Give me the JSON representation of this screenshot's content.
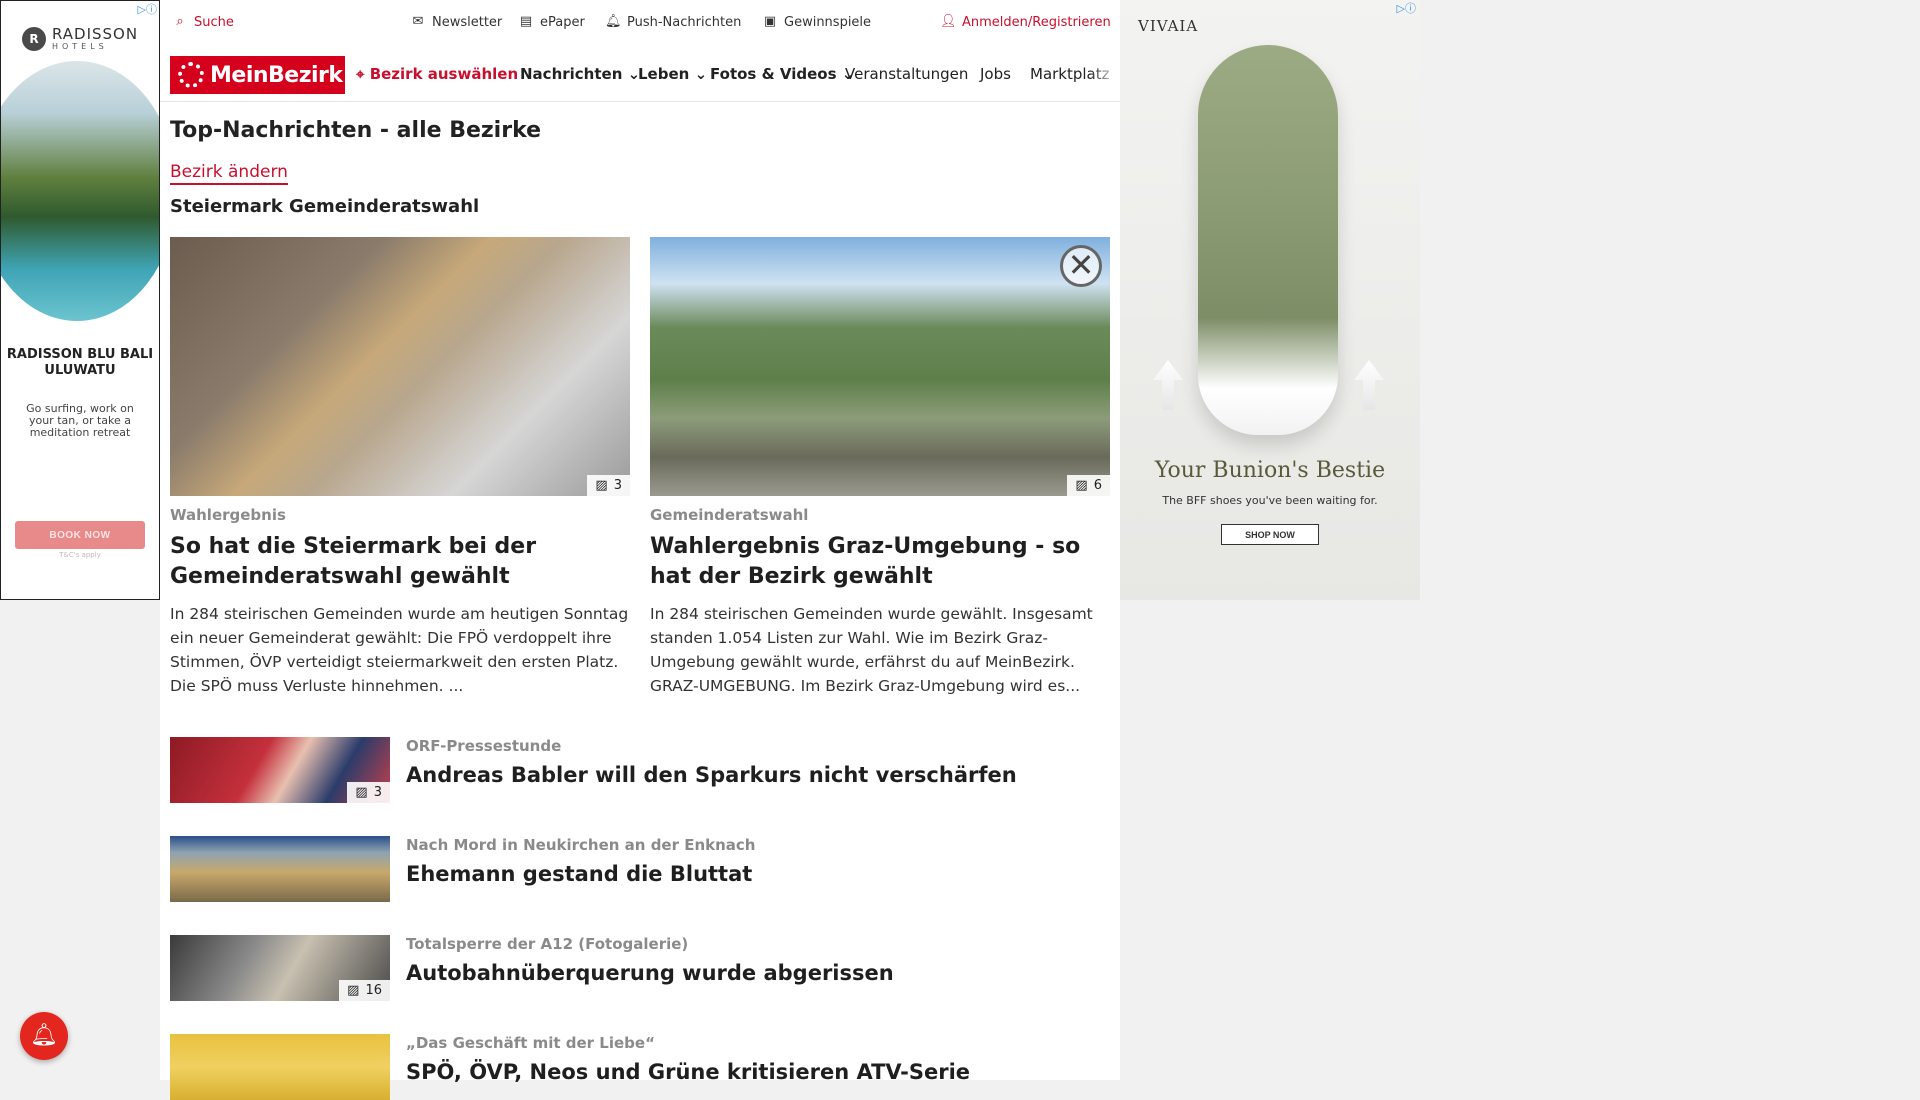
{
  "ad_left": {
    "brand": "RADISSON",
    "brand_sub": "HOTELS",
    "headline": "RADISSON BLU BALI ULUWATU",
    "copy": "Go surfing, work on your tan, or take a meditation retreat",
    "cta": "BOOK NOW",
    "fine_print": "T&C's apply"
  },
  "topbar": {
    "search": "Suche",
    "newsletter": "Newsletter",
    "epaper": "ePaper",
    "push": "Push-Nachrichten",
    "games": "Gewinnspiele",
    "login": "Anmelden/Registrieren"
  },
  "nav": {
    "brand": "MeinBezirk",
    "district": "Bezirk auswählen",
    "items": [
      "Nachrichten",
      "Leben",
      "Fotos & Videos",
      "Veranstaltungen",
      "Jobs",
      "Marktplatz"
    ]
  },
  "page": {
    "title": "Top-Nachrichten - alle Bezirke",
    "change_link": "Bezirk ändern",
    "section": "Steiermark Gemeinderatswahl"
  },
  "features": [
    {
      "kicker": "Wahlergebnis",
      "headline": "So hat die Steiermark bei der Gemeinderatswahl gewählt",
      "teaser": "In 284 steirischen Gemeinden wurde am heutigen Sonntag ein neuer Gemeinderat gewählt: Die FPÖ verdoppelt ihre Stimmen, ÖVP verteidigt steiermarkweit den ersten Platz. Die SPÖ muss Verluste hinnehmen. ...",
      "photo_count": "3"
    },
    {
      "kicker": "Gemeinderatswahl",
      "headline": "Wahlergebnis Graz-Umgebung - so hat der Bezirk gewählt",
      "teaser": "In 284 steirischen Gemeinden wurde gewählt. Insgesamt standen 1.054 Listen zur Wahl. Wie im Bezirk Graz-Umgebung gewählt wurde, erfährst du auf MeinBezirk. GRAZ-UMGEBUNG. Im Bezirk Graz-Umgebung wird es...",
      "photo_count": "6"
    }
  ],
  "list": [
    {
      "kicker": "ORF-Pressestunde",
      "headline": "Andreas Babler will den Sparkurs nicht verschärfen",
      "photo_count": "3"
    },
    {
      "kicker": "Nach Mord in Neukirchen an der Enknach",
      "headline": "Ehemann gestand die Bluttat",
      "photo_count": ""
    },
    {
      "kicker": "Totalsperre der A12 (Fotogalerie)",
      "headline": "Autobahnüberquerung wurde abgerissen",
      "photo_count": "16"
    },
    {
      "kicker": "„Das Geschäft mit der Liebe“",
      "headline": "SPÖ, ÖVP, Neos und Grüne kritisieren ATV-Serie",
      "photo_count": ""
    }
  ],
  "ad_right": {
    "brand": "VIVAIA",
    "tagline": "Your Bunion's Bestie",
    "sub": "The BFF shoes you've been waiting for.",
    "cta": "SHOP NOW"
  },
  "colors": {
    "brand_red": "#d5001c",
    "link_red": "#c8102e"
  }
}
